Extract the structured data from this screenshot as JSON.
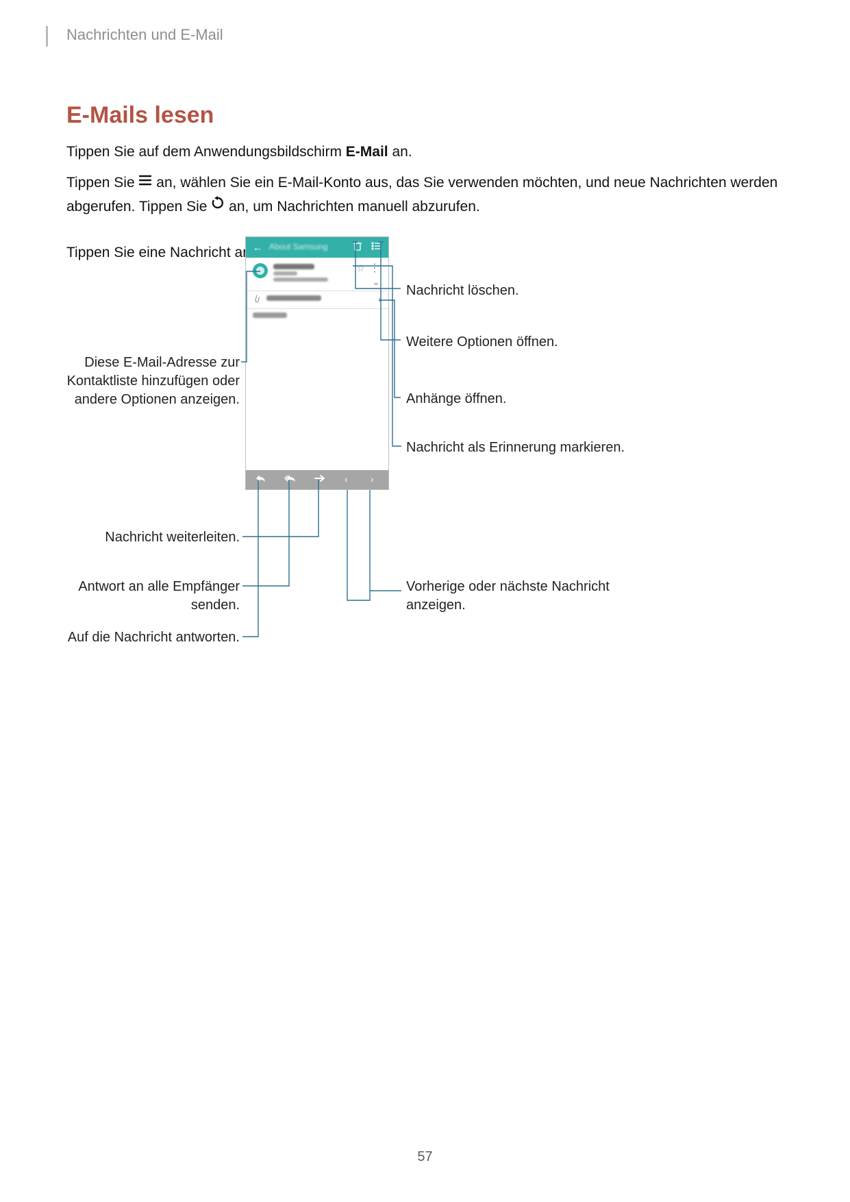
{
  "header": {
    "breadcrumb": "Nachrichten und E-Mail"
  },
  "section": {
    "title": "E-Mails lesen"
  },
  "para1": {
    "t1": "Tippen Sie auf dem Anwendungsbildschirm ",
    "bold": "E-Mail",
    "t2": " an."
  },
  "para2": {
    "pre": "Tippen Sie ",
    "mid": " an, wählen Sie ein E-Mail-Konto aus, das Sie verwenden möchten, und neue Nachrichten werden abgerufen. Tippen Sie ",
    "post": " an, um Nachrichten manuell abzurufen."
  },
  "para3": {
    "text": "Tippen Sie eine Nachricht an, um diese zu lesen."
  },
  "phone": {
    "title": "About Samsung"
  },
  "callouts": {
    "delete": "Nachricht löschen.",
    "more_options": "Weitere Optionen öffnen.",
    "contact": "Diese E-Mail-Adresse zur Kontaktliste hinzufügen oder andere Optionen anzeigen.",
    "attachments": "Anhänge öffnen.",
    "reminder": "Nachricht als Erinnerung markieren.",
    "forward": "Nachricht weiterleiten.",
    "reply_all": "Antwort an alle Empfänger senden.",
    "prev_next": "Vorherige oder nächste Nachricht anzeigen.",
    "reply": "Auf die Nachricht antworten."
  },
  "footer": {
    "page": "57"
  }
}
